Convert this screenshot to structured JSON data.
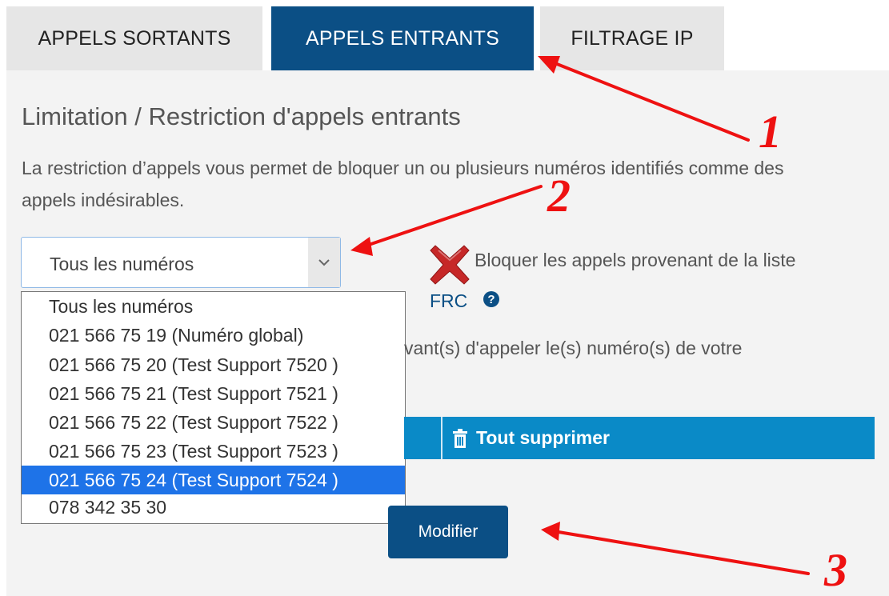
{
  "tabs": [
    {
      "label": "APPELS SORTANTS"
    },
    {
      "label": "APPELS ENTRANTS"
    },
    {
      "label": "FILTRAGE IP"
    }
  ],
  "active_tab": "APPELS ENTRANTS",
  "heading": "Limitation / Restriction d'appels entrants",
  "description": "La restriction d’appels vous permet de bloquer un ou plusieurs numéros identifiés comme des appels indésirables.",
  "number_select": {
    "value": "Tous les numéros",
    "options": [
      "Tous les numéros",
      "021 566 75 19 (Numéro global)",
      "021 566 75 20 (Test Support 7520 )",
      "021 566 75 21 (Test Support 7521 )",
      "021 566 75 22 (Test Support 7522 )",
      "021 566 75 23 (Test Support 7523 )",
      "021 566 75 24 (Test Support 7524 )",
      "078 342 35 30"
    ],
    "highlighted": "021 566 75 24 (Test Support 7524 )"
  },
  "frc": {
    "label": "Bloquer les appels provenant de la liste",
    "label_line2": "FRC",
    "help": "?"
  },
  "partial_text": "vant(s) d'appeler le(s) numéro(s) de votre",
  "actions": {
    "delete_all": "Tout supprimer"
  },
  "modify_button": "Modifier",
  "annotations": {
    "marker_1": "1",
    "marker_2": "2",
    "marker_3": "3"
  },
  "colors": {
    "primary": "#0b4f85",
    "bar": "#0a8ac7",
    "annotation": "#ee1111",
    "highlight": "#1e73e8"
  }
}
